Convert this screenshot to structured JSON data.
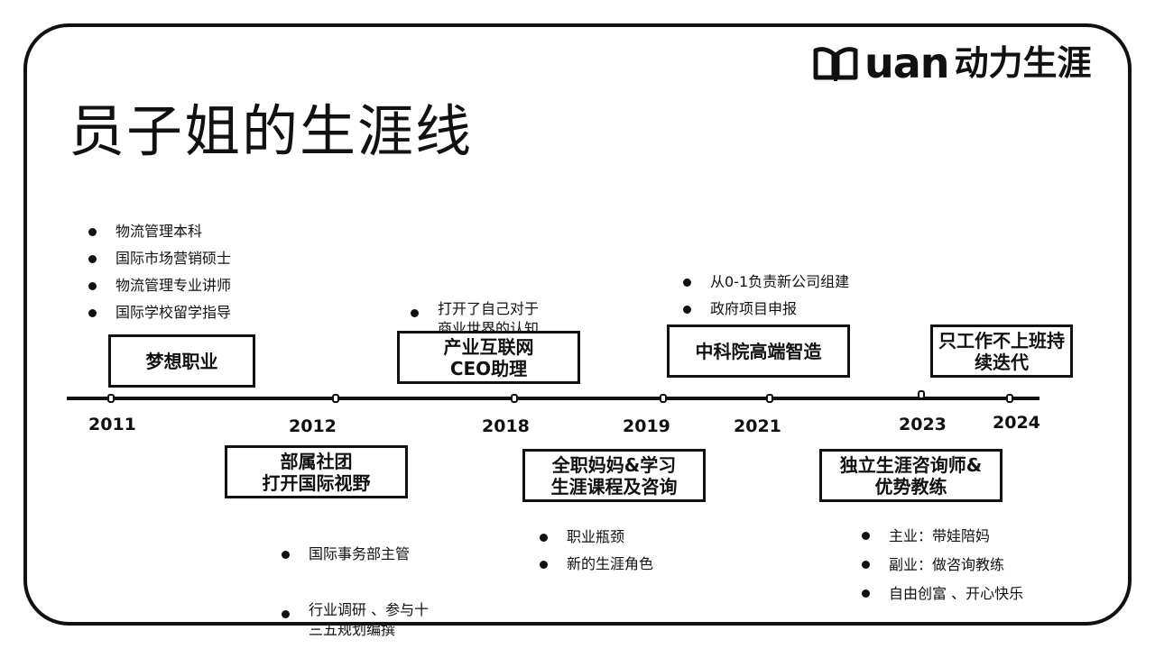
{
  "logo": {
    "latin": "uan",
    "chinese": "动力生涯",
    "icon": "open-book-icon"
  },
  "title": "员子姐的生涯线",
  "years": [
    "2011",
    "2012",
    "2018",
    "2019",
    "2021",
    "2023",
    "2024"
  ],
  "milestones": {
    "dream_job": [
      "梦想职业"
    ],
    "club": [
      "部属社团",
      "打开国际视野"
    ],
    "ceo_assistant": [
      "产业互联网",
      "CEO助理"
    ],
    "full_time_mom": [
      "全职妈妈&学习",
      "生涯课程及咨询"
    ],
    "cas": [
      "中科院高端智造"
    ],
    "consultant": [
      "独立生涯咨询师&",
      "优势教练"
    ],
    "iterate": [
      "只工作不上班持",
      "续迭代"
    ]
  },
  "notes": {
    "y2011": [
      "物流管理本科",
      "国际市场营销硕士",
      "物流管理专业讲师",
      "国际学校留学指导"
    ],
    "y2012": [
      "国际事务部主管",
      "行业调研 、参与十\n三五规划编撰"
    ],
    "y2018": [
      "打开了自己对于\n商业世界的认知"
    ],
    "y2019_below": [
      "职业瓶颈",
      "新的生涯角色"
    ],
    "y2021": [
      "从0-1负责新公司组建",
      "政府项目申报"
    ],
    "y2023": [
      "主业：带娃陪妈",
      "副业：做咨询教练",
      "自由创富 、开心快乐"
    ]
  }
}
